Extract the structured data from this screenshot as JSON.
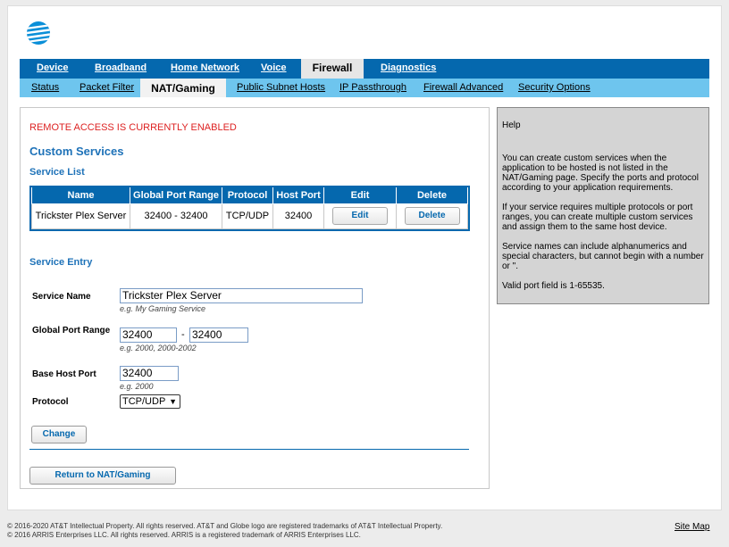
{
  "brand": {
    "logo_icon": "att-globe-icon",
    "color": "#0568ae"
  },
  "topnav": {
    "items": [
      {
        "label": "Device"
      },
      {
        "label": "Broadband"
      },
      {
        "label": "Home Network"
      },
      {
        "label": "Voice"
      },
      {
        "label": "Firewall"
      },
      {
        "label": "Diagnostics"
      }
    ],
    "active": "Firewall"
  },
  "subnav": {
    "items": [
      {
        "label": "Status"
      },
      {
        "label": "Packet Filter"
      },
      {
        "label": "NAT/Gaming"
      },
      {
        "label": "Public Subnet Hosts"
      },
      {
        "label": "IP Passthrough"
      },
      {
        "label": "Firewall Advanced"
      },
      {
        "label": "Security Options"
      }
    ],
    "active": "NAT/Gaming"
  },
  "main": {
    "remote_access": "REMOTE ACCESS IS CURRENTLY ENABLED",
    "title": "Custom Services",
    "service_list_title": "Service List",
    "table": {
      "headers": [
        "Name",
        "Global Port Range",
        "Protocol",
        "Host Port",
        "Edit",
        "Delete"
      ],
      "rows": [
        {
          "name": "Trickster Plex Server",
          "range": "32400 - 32400",
          "protocol": "TCP/UDP",
          "host_port": "32400",
          "edit": "Edit",
          "delete": "Delete"
        }
      ]
    },
    "entry": {
      "title": "Service Entry",
      "service_name_label": "Service Name",
      "service_name_value": "Trickster Plex Server",
      "service_name_hint": "e.g. My Gaming Service",
      "port_range_label": "Global Port Range",
      "port_start": "32400",
      "port_dash": "-",
      "port_end": "32400",
      "port_range_hint": "e.g. 2000, 2000-2002",
      "base_host_port_label": "Base Host Port",
      "base_host_port_value": "32400",
      "base_host_port_hint": "e.g. 2000",
      "protocol_label": "Protocol",
      "protocol_value": "TCP/UDP",
      "change_button": "Change",
      "return_button": "Return to NAT/Gaming"
    }
  },
  "help": {
    "title": "Help",
    "paragraphs": [
      "You can create custom services when the application to be hosted is not listed in the NAT/Gaming page. Specify the ports and protocol according to your application requirements.",
      "If your service requires multiple protocols or port ranges, you can create multiple custom services and assign them to the same host device.",
      "Service names can include alphanumerics and special characters, but cannot begin with a number or \".",
      "Valid port field is 1-65535."
    ]
  },
  "footer": {
    "line1": "© 2016-2020 AT&T Intellectual Property. All rights reserved. AT&T and Globe logo are registered trademarks of AT&T Intellectual Property.",
    "line2": "© 2016 ARRIS Enterprises LLC. All rights reserved. ARRIS is a registered trademark of ARRIS Enterprises LLC.",
    "site_map": "Site Map"
  }
}
